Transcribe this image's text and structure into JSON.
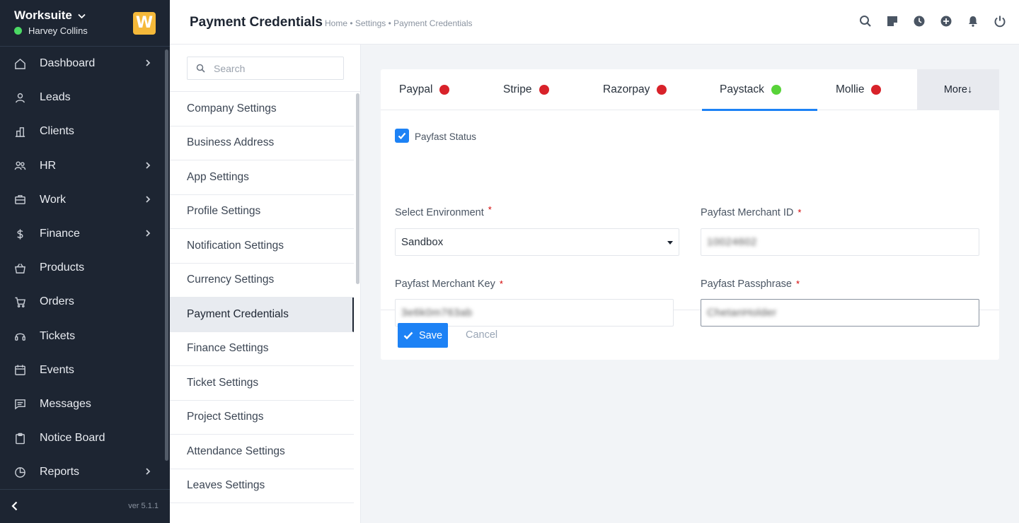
{
  "sidebar": {
    "brand": "Worksuite",
    "user_name": "Harvey Collins",
    "logo_letter": "W",
    "version": "ver 5.1.1",
    "items": [
      {
        "label": "Dashboard",
        "icon": "home-icon",
        "has_arrow": true
      },
      {
        "label": "Leads",
        "icon": "user-icon",
        "has_arrow": false
      },
      {
        "label": "Clients",
        "icon": "building-icon",
        "has_arrow": false
      },
      {
        "label": "HR",
        "icon": "people-icon",
        "has_arrow": true
      },
      {
        "label": "Work",
        "icon": "briefcase-icon",
        "has_arrow": true
      },
      {
        "label": "Finance",
        "icon": "dollar-icon",
        "has_arrow": true
      },
      {
        "label": "Products",
        "icon": "basket-icon",
        "has_arrow": false
      },
      {
        "label": "Orders",
        "icon": "cart-icon",
        "has_arrow": false
      },
      {
        "label": "Tickets",
        "icon": "headset-icon",
        "has_arrow": false
      },
      {
        "label": "Events",
        "icon": "calendar-icon",
        "has_arrow": false
      },
      {
        "label": "Messages",
        "icon": "chat-icon",
        "has_arrow": false
      },
      {
        "label": "Notice Board",
        "icon": "clipboard-icon",
        "has_arrow": false
      },
      {
        "label": "Reports",
        "icon": "pie-chart-icon",
        "has_arrow": true
      }
    ]
  },
  "header": {
    "title": "Payment Credentials",
    "breadcrumb": "Home • Settings • Payment Credentials"
  },
  "settings_menu": {
    "search_placeholder": "Search",
    "items": [
      "Company Settings",
      "Business Address",
      "App Settings",
      "Profile Settings",
      "Notification Settings",
      "Currency Settings",
      "Payment Credentials",
      "Finance Settings",
      "Ticket Settings",
      "Project Settings",
      "Attendance Settings",
      "Leaves Settings"
    ],
    "active_index": 6
  },
  "tabs": {
    "items": [
      {
        "label": "Paypal",
        "status_color": "#d8222a"
      },
      {
        "label": "Stripe",
        "status_color": "#d8222a"
      },
      {
        "label": "Razorpay",
        "status_color": "#d8222a"
      },
      {
        "label": "Paystack",
        "status_color": "#58d339"
      },
      {
        "label": "Mollie",
        "status_color": "#d8222a"
      }
    ],
    "active_index": 3,
    "more_label": "More↓"
  },
  "form": {
    "status_label": "Payfast Status",
    "status_checked": true,
    "environment_label": "Select Environment",
    "environment_value": "Sandbox",
    "merchant_id_label": "Payfast Merchant ID",
    "merchant_id_value": "10024602",
    "merchant_key_label": "Payfast Merchant Key",
    "merchant_key_value": "3e6k0m763ab",
    "passphrase_label": "Payfast Passphrase",
    "passphrase_value": "ChetanHolder",
    "required_mark": "*"
  },
  "actions": {
    "save_label": "Save",
    "cancel_label": "Cancel"
  },
  "colors": {
    "accent": "#1d82f5",
    "sidebar_bg": "#1d2532",
    "status_red": "#d8222a",
    "status_green": "#58d339"
  }
}
